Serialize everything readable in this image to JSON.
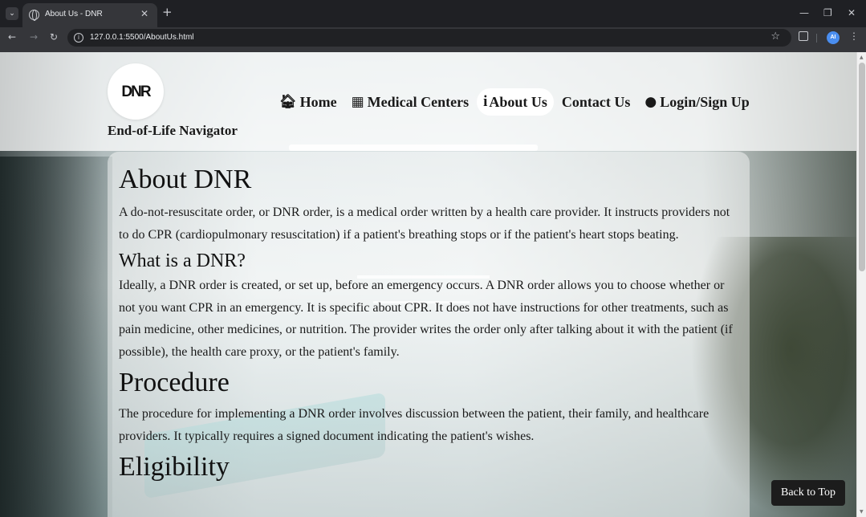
{
  "browser": {
    "tab_title": "About Us - DNR",
    "url": "127.0.0.1:5500/AboutUs.html",
    "profile_initials": "AI",
    "icons": {
      "tab_menu": "chevron-down-icon",
      "back": "arrow-left-icon",
      "forward": "arrow-right-icon",
      "reload": "reload-icon",
      "site_info": "info-icon",
      "bookmark": "star-icon",
      "extensions": "puzzle-icon",
      "menu": "kebab-menu-icon"
    }
  },
  "header": {
    "logo_text": "DNR",
    "site_name": "End-of-Life Navigator",
    "nav": [
      {
        "label": "Home",
        "icon": "home-icon",
        "active": false
      },
      {
        "label": "Medical Centers",
        "icon": "hospital-icon",
        "active": false
      },
      {
        "label": "About Us",
        "icon": "info-icon",
        "active": true
      },
      {
        "label": "Contact Us",
        "icon": "",
        "active": false
      },
      {
        "label": "Login/Sign Up",
        "icon": "user-icon",
        "active": false
      }
    ]
  },
  "content": {
    "about_title": "About DNR",
    "about_text": "A do-not-resuscitate order, or DNR order, is a medical order written by a health care provider. It instructs providers not to do CPR (cardiopulmonary resuscitation) if a patient's breathing stops or if the patient's heart stops beating.",
    "what_title": "What is a DNR?",
    "what_text": "Ideally, a DNR order is created, or set up, before an emergency occurs. A DNR order allows you to choose whether or not you want CPR in an emergency. It is specific about CPR. It does not have instructions for other treatments, such as pain medicine, other medicines, or nutrition. The provider writes the order only after talking about it with the patient (if possible), the health care proxy, or the patient's family.",
    "procedure_title": "Procedure",
    "procedure_text": "The procedure for implementing a DNR order involves discussion between the patient, their family, and healthcare providers. It typically requires a signed document indicating the patient's wishes.",
    "eligibility_title": "Eligibility"
  },
  "back_to_top_label": "Back to Top"
}
